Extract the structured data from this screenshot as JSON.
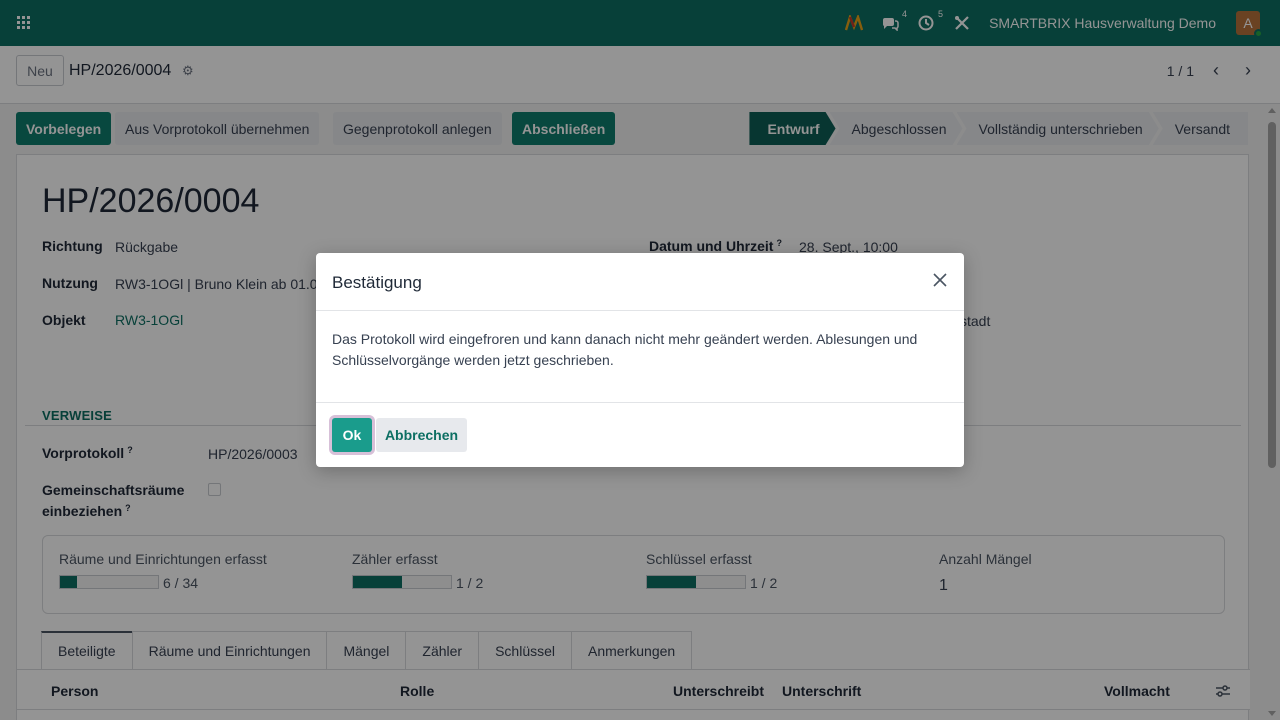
{
  "navbar": {
    "company": "SMARTBRIX Hausverwaltung Demo",
    "messages_count": "4",
    "activities_count": "5",
    "avatar_letter": "A",
    "color": "#0d6f63"
  },
  "control": {
    "new_label": "Neu",
    "record_title": "HP/2026/0004",
    "pager": "1 / 1"
  },
  "statusbar": {
    "buttons": [
      "Vorbelegen",
      "Aus Vorprotokoll übernehmen",
      "Gegenprotokoll anlegen",
      "Abschließen"
    ],
    "stages": [
      "Entwurf",
      "Abgeschlossen",
      "Vollständig unterschrieben",
      "Versandt"
    ],
    "active_stage": "Entwurf"
  },
  "form": {
    "title": "HP/2026/0004",
    "richtung_label": "Richtung",
    "richtung_value": "Rückgabe",
    "nutzung_label": "Nutzung",
    "nutzung_value": "RW3-1OGl | Bruno Klein ab 01.08",
    "objekt_label": "Objekt",
    "objekt_value": "RW3-1OGl",
    "datum_label": "Datum und Uhrzeit",
    "datum_value": "28. Sept., 10:00",
    "partial_right": "stadt",
    "section_verweise": "VERWEISE",
    "vorprotokoll_label": "Vorprotokoll",
    "vorprotokoll_value": "HP/2026/0003",
    "gemeinschaft_label_1": "Gemeinschaftsräume",
    "gemeinschaft_label_2": "einbeziehen",
    "help_mark": "?"
  },
  "stats": {
    "raeume_label": "Räume und Einrichtungen erfasst",
    "raeume_value": "6 / 34",
    "raeume_fraction": 0.176,
    "zaehler_label": "Zähler erfasst",
    "zaehler_value": "1 / 2",
    "zaehler_fraction": 0.5,
    "schluessel_label": "Schlüssel erfasst",
    "schluessel_value": "1 / 2",
    "schluessel_fraction": 0.5,
    "maengel_label": "Anzahl Mängel",
    "maengel_value": "1"
  },
  "tabs": [
    "Beteiligte",
    "Räume und Einrichtungen",
    "Mängel",
    "Zähler",
    "Schlüssel",
    "Anmerkungen"
  ],
  "table": {
    "headers": [
      "Person",
      "Rolle",
      "Unterschreibt",
      "Unterschrift",
      "Vollmacht"
    ]
  },
  "dialog": {
    "title": "Bestätigung",
    "body_line1": "Das Protokoll wird eingefroren und kann danach nicht mehr geändert werden. Ablesungen und",
    "body_line2": "Schlüsselvorgänge werden jetzt geschrieben.",
    "ok_label": "Ok",
    "cancel_label": "Abbrechen"
  }
}
